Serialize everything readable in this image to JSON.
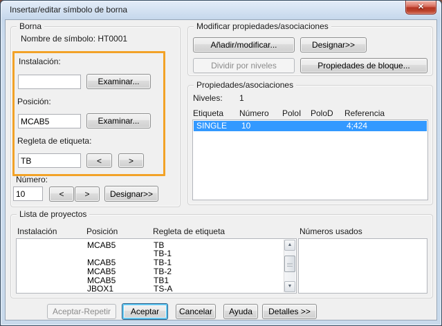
{
  "window": {
    "title": "Insertar/editar símbolo de borna"
  },
  "icons": {
    "close": "✕",
    "scroll_up": "▲",
    "scroll_down": "▼"
  },
  "borna": {
    "group_label": "Borna",
    "nombre_label": "Nombre de símbolo:",
    "nombre_value": "HT0001",
    "instalacion_label": "Instalación:",
    "instalacion_value": "",
    "instalacion_examinar_label": "Examinar...",
    "posicion_label": "Posición:",
    "posicion_value": "MCAB5",
    "posicion_examinar_label": "Examinar...",
    "regleta_label": "Regleta de etiqueta:",
    "regleta_value": "TB",
    "regleta_prev_label": "<",
    "regleta_next_label": ">",
    "numero_label": "Número:",
    "numero_value": "10",
    "numero_prev_label": "<",
    "numero_next_label": ">",
    "numero_designar_label": "Designar>>"
  },
  "modificar": {
    "group_label": "Modificar propiedades/asociaciones",
    "anadir_label": "Añadir/modificar...",
    "designar_label": "Designar>>",
    "dividir_label": "Dividir por niveles",
    "bloque_label": "Propiedades de bloque..."
  },
  "propiedades": {
    "group_label": "Propiedades/asociaciones",
    "niveles_label": "Niveles:",
    "niveles_value": "1",
    "columns": [
      "Etiqueta",
      "Número",
      "PoloI",
      "PoloD",
      "Referencia"
    ],
    "row": {
      "etiqueta": "SINGLE",
      "numero": "10",
      "poloi": "",
      "polod": "",
      "referencia": "4;424"
    }
  },
  "proyectos": {
    "group_label": "Lista de proyectos",
    "columns": [
      "Instalación",
      "Posición",
      "Regleta de etiqueta"
    ],
    "rows": [
      {
        "instalacion": "",
        "posicion": "MCAB5",
        "regleta": "TB"
      },
      {
        "instalacion": "",
        "posicion": "",
        "regleta": "TB-1"
      },
      {
        "instalacion": "",
        "posicion": "MCAB5",
        "regleta": "TB-1"
      },
      {
        "instalacion": "",
        "posicion": "MCAB5",
        "regleta": "TB-2"
      },
      {
        "instalacion": "",
        "posicion": "MCAB5",
        "regleta": "TB1"
      },
      {
        "instalacion": "",
        "posicion": "JBOX1",
        "regleta": "TS-A"
      }
    ],
    "numeros_label": "Números usados"
  },
  "footer": {
    "aceptar_repetir_label": "Aceptar-Repetir",
    "aceptar_label": "Aceptar",
    "cancelar_label": "Cancelar",
    "ayuda_label": "Ayuda",
    "detalles_label": "Detalles >>"
  },
  "colors": {
    "accent_orange": "#f2a227",
    "selection_blue": "#3399ff",
    "close_red": "#c5473a",
    "dialog_bg": "#f0f0f0",
    "titlebar_blue": "#c9daec"
  }
}
